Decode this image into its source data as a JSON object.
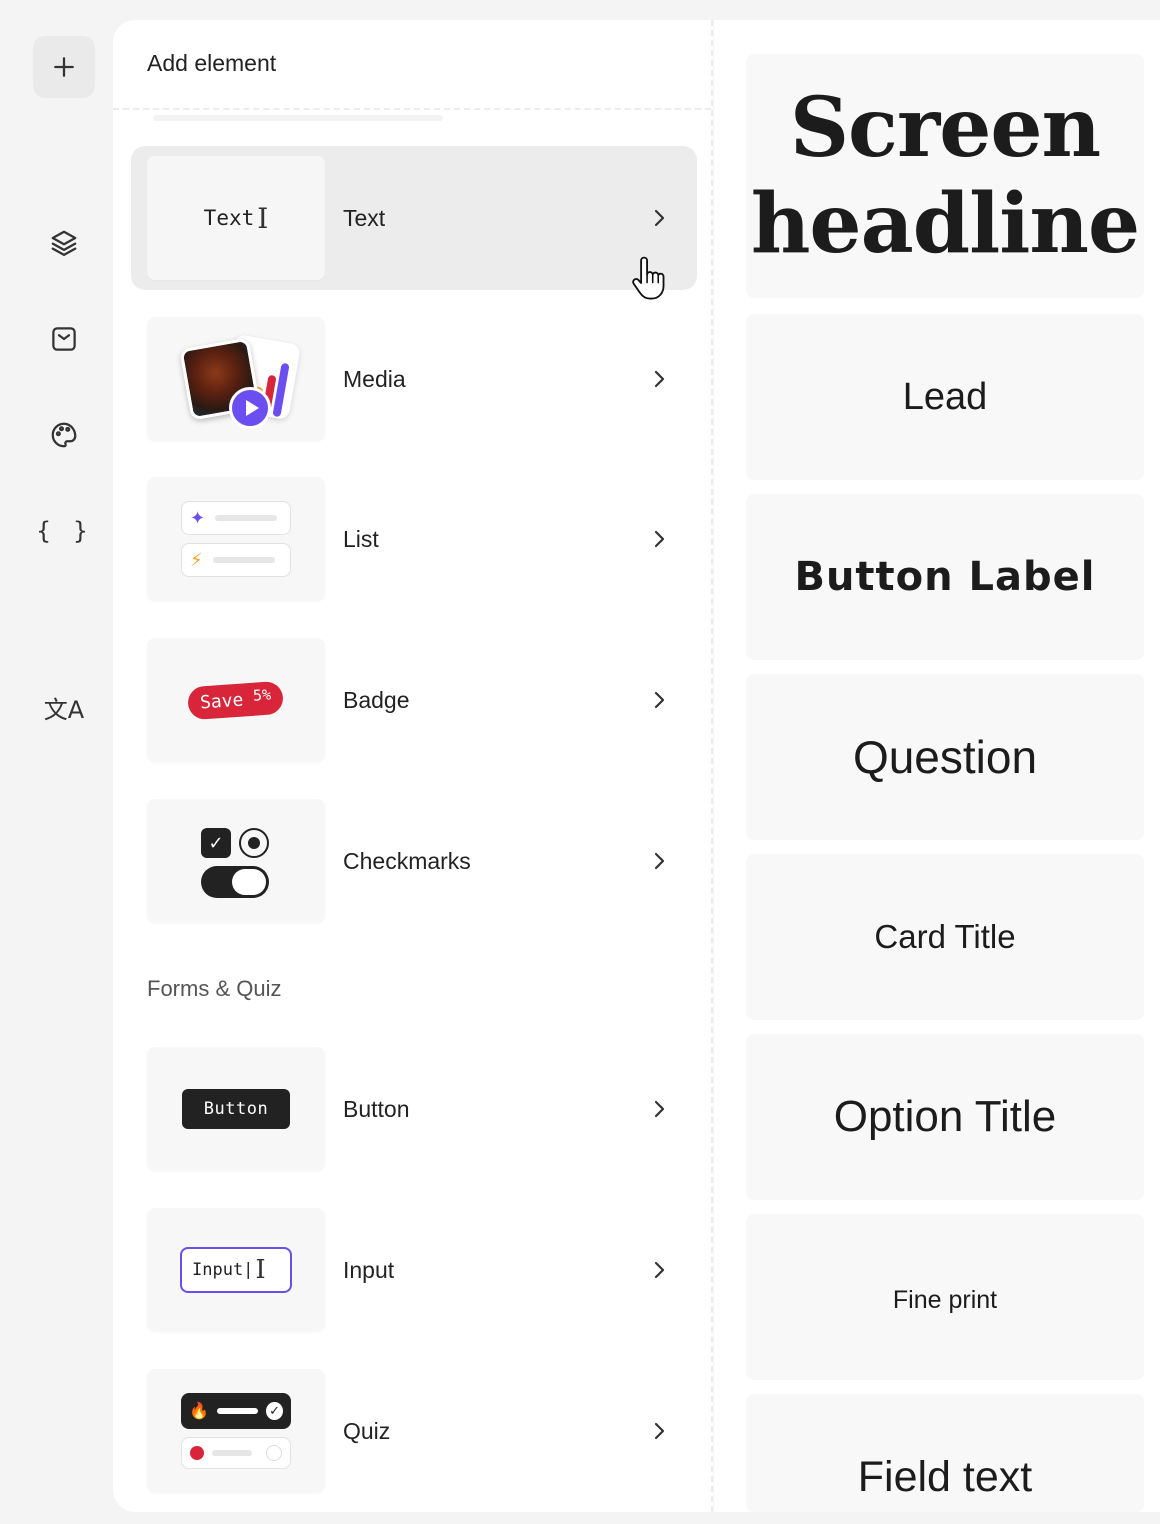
{
  "rail": {
    "add_icon": "plus-icon",
    "icons": [
      "layers-icon",
      "inbox-icon",
      "palette-icon",
      "braces-icon",
      "translate-icon"
    ],
    "braces_glyph": "{ }",
    "translate_glyph": "文A"
  },
  "panel": {
    "title": "Add element",
    "items": [
      {
        "label": "Text",
        "thumb_text": "Text"
      },
      {
        "label": "Media"
      },
      {
        "label": "List"
      },
      {
        "label": "Badge",
        "badge_text": "Save",
        "badge_pct": "5%"
      },
      {
        "label": "Checkmarks"
      }
    ],
    "section_forms": "Forms & Quiz",
    "form_items": [
      {
        "label": "Button",
        "thumb_text": "Button"
      },
      {
        "label": "Input",
        "thumb_text": "Input|"
      },
      {
        "label": "Quiz"
      }
    ]
  },
  "preview": {
    "headline": "Screen headline",
    "lead": "Lead",
    "button_label": "Button Label",
    "question": "Question",
    "card_title": "Card Title",
    "option_title": "Option Title",
    "fine_print": "Fine print",
    "field_text": "Field text"
  },
  "colors": {
    "accent_purple": "#6b4ef0",
    "badge_red": "#d8253a",
    "dark": "#222222"
  }
}
